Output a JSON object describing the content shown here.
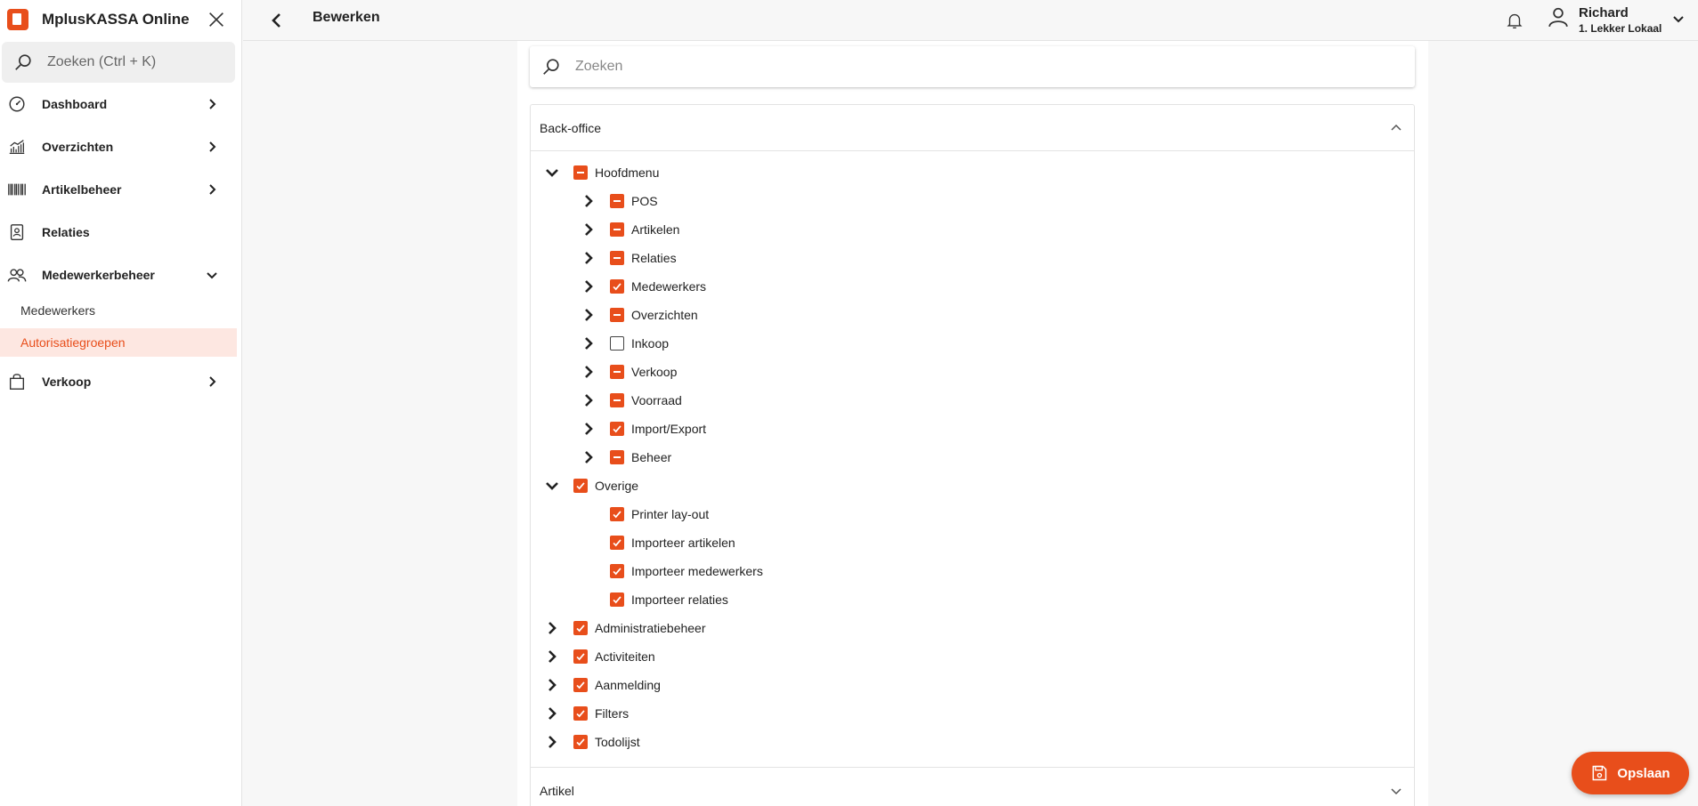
{
  "sidebar": {
    "app_title": "MplusKASSA Online",
    "search_placeholder": "Zoeken (Ctrl + K)",
    "items": [
      {
        "label": "Dashboard",
        "icon": "gauge-icon"
      },
      {
        "label": "Overzichten",
        "icon": "chart-icon"
      },
      {
        "label": "Artikelbeheer",
        "icon": "barcode-icon"
      },
      {
        "label": "Relaties",
        "icon": "contact-icon"
      },
      {
        "label": "Medewerkerbeheer",
        "icon": "users-icon"
      },
      {
        "label": "Verkoop",
        "icon": "bag-icon"
      }
    ],
    "sub_items": [
      {
        "label": "Medewerkers"
      },
      {
        "label": "Autorisatiegroepen",
        "active": true
      }
    ]
  },
  "header": {
    "title": "Bewerken",
    "user_name": "Richard",
    "user_org": "1. Lekker Lokaal"
  },
  "main": {
    "search_placeholder": "Zoeken",
    "section_open": "Back-office",
    "section_closed": "Artikel",
    "tree": [
      {
        "label": "Hoofdmenu",
        "level": 0,
        "state": "partial",
        "toggle": "expanded"
      },
      {
        "label": "POS",
        "level": 1,
        "state": "partial",
        "toggle": "collapsed"
      },
      {
        "label": "Artikelen",
        "level": 1,
        "state": "partial",
        "toggle": "collapsed"
      },
      {
        "label": "Relaties",
        "level": 1,
        "state": "partial",
        "toggle": "collapsed"
      },
      {
        "label": "Medewerkers",
        "level": 1,
        "state": "checked",
        "toggle": "collapsed"
      },
      {
        "label": "Overzichten",
        "level": 1,
        "state": "partial",
        "toggle": "collapsed"
      },
      {
        "label": "Inkoop",
        "level": 1,
        "state": "empty",
        "toggle": "collapsed"
      },
      {
        "label": "Verkoop",
        "level": 1,
        "state": "partial",
        "toggle": "collapsed"
      },
      {
        "label": "Voorraad",
        "level": 1,
        "state": "partial",
        "toggle": "collapsed"
      },
      {
        "label": "Import/Export",
        "level": 1,
        "state": "checked",
        "toggle": "collapsed"
      },
      {
        "label": "Beheer",
        "level": 1,
        "state": "partial",
        "toggle": "collapsed"
      },
      {
        "label": "Overige",
        "level": 0,
        "state": "checked",
        "toggle": "expanded"
      },
      {
        "label": "Printer lay-out",
        "level": 1,
        "state": "checked",
        "toggle": "none"
      },
      {
        "label": "Importeer artikelen",
        "level": 1,
        "state": "checked",
        "toggle": "none"
      },
      {
        "label": "Importeer medewerkers",
        "level": 1,
        "state": "checked",
        "toggle": "none"
      },
      {
        "label": "Importeer relaties",
        "level": 1,
        "state": "checked",
        "toggle": "none"
      },
      {
        "label": "Administratiebeheer",
        "level": 0,
        "state": "checked",
        "toggle": "collapsed"
      },
      {
        "label": "Activiteiten",
        "level": 0,
        "state": "checked",
        "toggle": "collapsed"
      },
      {
        "label": "Aanmelding",
        "level": 0,
        "state": "checked",
        "toggle": "collapsed"
      },
      {
        "label": "Filters",
        "level": 0,
        "state": "checked",
        "toggle": "collapsed"
      },
      {
        "label": "Todolijst",
        "level": 0,
        "state": "checked",
        "toggle": "collapsed"
      }
    ]
  },
  "save_label": "Opslaan",
  "colors": {
    "accent": "#e84e1b",
    "active_bg": "#fde7e1"
  }
}
